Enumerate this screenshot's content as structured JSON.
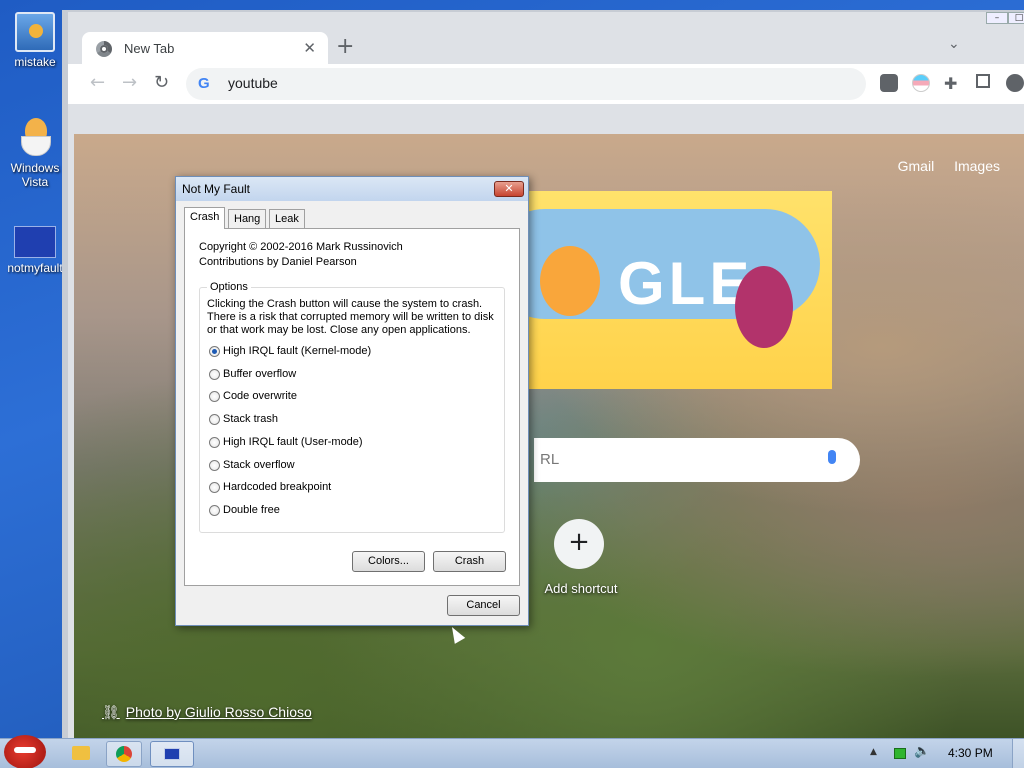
{
  "desktop": {
    "icons": [
      {
        "label": "mistake"
      },
      {
        "label": "Windows Vista"
      },
      {
        "label": "notmyfault"
      }
    ]
  },
  "browser": {
    "tab_title": "New Tab",
    "address_text": "youtube",
    "ntp": {
      "link_gmail": "Gmail",
      "link_images": "Images",
      "search_hint": "RL",
      "add_shortcut_label": "Add shortcut",
      "photo_credit": "Photo by Giulio Rosso Chioso"
    }
  },
  "dialog": {
    "title": "Not My Fault",
    "tabs": [
      "Crash",
      "Hang",
      "Leak"
    ],
    "copyright": "Copyright © 2002-2016 Mark Russinovich",
    "contributions": "Contributions by Daniel Pearson",
    "options_label": "Options",
    "warning_line1": "Clicking the Crash button will cause the system to crash.",
    "warning_line2": "There is a risk that corrupted memory will be written to disk",
    "warning_line3": "or that work may be lost. Close any open applications.",
    "options": [
      "High IRQL fault (Kernel-mode)",
      "Buffer overflow",
      "Code overwrite",
      "Stack trash",
      "High IRQL fault (User-mode)",
      "Stack overflow",
      "Hardcoded breakpoint",
      "Double free"
    ],
    "selected_option": "High IRQL fault (Kernel-mode)",
    "colors_button": "Colors...",
    "crash_button": "Crash",
    "cancel_button": "Cancel"
  },
  "taskbar": {
    "time": "4:30 PM"
  },
  "colors": {
    "accent": "#1d5ab4",
    "close_red": "#c74430"
  }
}
